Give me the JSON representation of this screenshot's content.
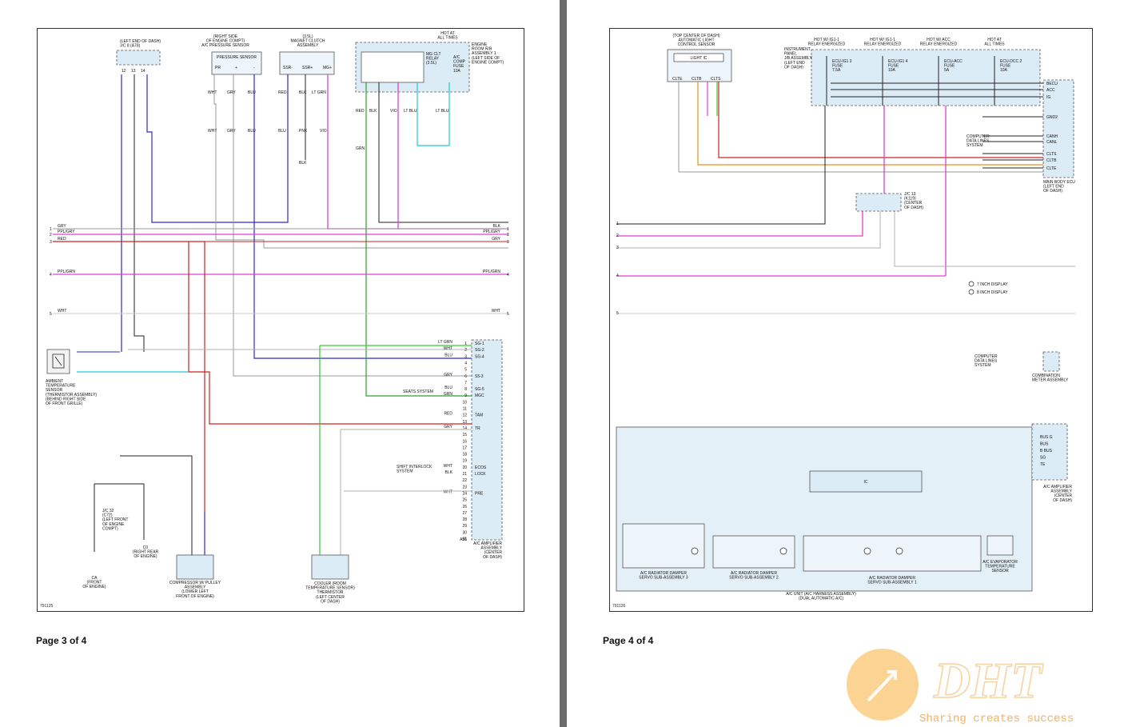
{
  "page3": {
    "footer": "Page 3 of 4",
    "diagram_id": "791125",
    "components": {
      "jc8": [
        "(LEFT END OF DASH)",
        "J/C 8 (A78)"
      ],
      "pressure_loc": [
        "(RIGHT SIDE",
        "OF ENGINE COMPT)",
        "A/C PRESSURE SENSOR"
      ],
      "pressure_box": "PRESSURE SENSOR",
      "magnet_loc": [
        "(3.5L)",
        "MAGNET CLUTCH",
        "ASSEMBLY"
      ],
      "hot": [
        "HOT AT",
        "ALL TIMES"
      ],
      "relay_assy": [
        "ENGINE",
        "ROOM R/B",
        "ASSEMBLY 1",
        "(LEFT SIDE OF",
        "ENGINE COMPT)"
      ],
      "mg_relay": [
        "MG CLT",
        "RELAY",
        "(3.5L)"
      ],
      "ac_fuse": [
        "A/C",
        "COMP",
        "FUSE",
        "10A"
      ],
      "ambient": [
        "AMBIENT",
        "TEMPERATURE",
        "SENSOR",
        "(THERMISTOR ASSEMBLY)",
        "(BEHIND RIGHT SIDE",
        "OF FRONT GRILLE)"
      ],
      "jc32": [
        "J/C 32",
        "(C72)",
        "(LEFT FRONT",
        "OF ENGINE",
        "COMPT)"
      ],
      "c0": [
        "C0",
        "(RIGHT REAR",
        "OF ENGINE)"
      ],
      "ca": [
        "CA",
        "(FRONT",
        "OF ENGINE)"
      ],
      "compressor": [
        "COMPRESSOR W/ PULLEY",
        "ASSEMBLY",
        "(LOWER LEFT",
        "FRONT OF ENGINE)"
      ],
      "cooler": [
        "COOLER (ROOM",
        "TEMPERATURE SENSOR)",
        "THERMISTOR",
        "(LEFT CENTER",
        "OF DASH)"
      ],
      "amp": [
        "A/C AMPLIFIER",
        "ASSEMBLY",
        "(CENTER",
        "OF DASH)"
      ],
      "seats": "SEATS SYSTEM",
      "shift": [
        "SHIFT INTERLOCK",
        "SYSTEM"
      ]
    },
    "bus_left": [
      {
        "num": "1",
        "color": "GRY"
      },
      {
        "num": "2",
        "color": "PPL/GRY"
      },
      {
        "num": "3",
        "color": "RED"
      },
      {
        "num": "4",
        "color": "PPL/GRN"
      },
      {
        "num": "5",
        "color": "WHT"
      }
    ],
    "bus_right": [
      {
        "num": "1",
        "color": "BLK"
      },
      {
        "num": "2",
        "color": "PPL/GRY"
      },
      {
        "num": "3",
        "color": "GRY"
      },
      {
        "num": "4",
        "color": "PPL/GRN"
      },
      {
        "num": "5",
        "color": "WHT"
      }
    ],
    "amp_pins": [
      {
        "pin": "1",
        "sig": "SG-1",
        "wire": "LT GRN"
      },
      {
        "pin": "2",
        "sig": "SG-2",
        "wire": "WHT"
      },
      {
        "pin": "3",
        "sig": "SG-4",
        "wire": "BLU"
      },
      {
        "pin": "4",
        "sig": "",
        "wire": ""
      },
      {
        "pin": "5",
        "sig": "",
        "wire": ""
      },
      {
        "pin": "6",
        "sig": "S5-3",
        "wire": "GRY"
      },
      {
        "pin": "7",
        "sig": "",
        "wire": ""
      },
      {
        "pin": "8",
        "sig": "SG-5",
        "wire": "BLU"
      },
      {
        "pin": "9",
        "sig": "MGC",
        "wire": "GRN"
      },
      {
        "pin": "10",
        "sig": "",
        "wire": ""
      },
      {
        "pin": "11",
        "sig": "",
        "wire": ""
      },
      {
        "pin": "12",
        "sig": "TAM",
        "wire": "RED"
      },
      {
        "pin": "13",
        "sig": "",
        "wire": ""
      },
      {
        "pin": "14",
        "sig": "TR",
        "wire": "GRY"
      },
      {
        "pin": "15",
        "sig": "",
        "wire": ""
      },
      {
        "pin": "16",
        "sig": "",
        "wire": ""
      },
      {
        "pin": "17",
        "sig": "",
        "wire": ""
      },
      {
        "pin": "18",
        "sig": "",
        "wire": ""
      },
      {
        "pin": "19",
        "sig": "",
        "wire": ""
      },
      {
        "pin": "20",
        "sig": "ECOS",
        "wire": "WHT"
      },
      {
        "pin": "21",
        "sig": "LOCK",
        "wire": "BLK"
      },
      {
        "pin": "22",
        "sig": "",
        "wire": ""
      },
      {
        "pin": "23",
        "sig": "",
        "wire": ""
      },
      {
        "pin": "24",
        "sig": "PRE",
        "wire": "WHT"
      },
      {
        "pin": "25",
        "sig": "",
        "wire": ""
      },
      {
        "pin": "26",
        "sig": "",
        "wire": ""
      },
      {
        "pin": "27",
        "sig": "",
        "wire": ""
      },
      {
        "pin": "28",
        "sig": "",
        "wire": ""
      },
      {
        "pin": "29",
        "sig": "",
        "wire": ""
      },
      {
        "pin": "30",
        "sig": "",
        "wire": ""
      },
      {
        "pin": "31",
        "sig": "",
        "wire": ""
      }
    ],
    "amp_connector": "A56",
    "wire_colors": {
      "blu": "#2a2ad0",
      "pink": "#e040d0",
      "red": "#d02020",
      "grn": "#2ca02c",
      "ltgrn": "#33cc33",
      "ltblu": "#22c8d8",
      "gry": "#9a9a9a",
      "blk": "#222222",
      "vio": "#a050d0"
    }
  },
  "page4": {
    "footer": "Page 4 of 4",
    "diagram_id": "791126",
    "components": {
      "light_sensor": [
        "(TOP CENTER OF DASH)",
        "AUTOMATIC LIGHT",
        "CONTROL SENSOR"
      ],
      "light_ic": "LIGHT IC",
      "light_pins": [
        "CLTE",
        "CLTB",
        "CLTS"
      ],
      "ip_jb": [
        "INSTRUMENT",
        "PANEL",
        "J/B ASSEMBLY",
        "(LEFT END",
        "OF DASH)"
      ],
      "hots": [
        {
          "top": [
            "HOT W/ IG1-1",
            "RELAY ENERGIZED"
          ],
          "fuse": [
            "ECU-IG1 3",
            "FUSE",
            "7.5A"
          ]
        },
        {
          "top": [
            "HOT W/ IG1-1",
            "RELAY ENERGIZED"
          ],
          "fuse": [
            "ECU-IG1 4",
            "FUSE",
            "10A"
          ]
        },
        {
          "top": [
            "HOT W/ ACC",
            "RELAY ENERGIZED"
          ],
          "fuse": [
            "ECU-ACC",
            "FUSE",
            "5A"
          ]
        },
        {
          "top": [
            "HOT AT",
            "ALL TIMES"
          ],
          "fuse": [
            "ECU-DCC 2",
            "FUSE",
            "10A"
          ]
        }
      ],
      "main_ecu": [
        "MAIN BODY ECU",
        "(LEFT END",
        "OF DASH)"
      ],
      "ecu_pins": [
        "BECU",
        "ACC",
        "IG",
        "GND2",
        "CANH",
        "CANL",
        "CLTS",
        "CLTB",
        "CLTE"
      ],
      "jc13": [
        "J/C 13",
        "(K119)",
        "(CENTER",
        "OF DASH)"
      ],
      "disp7": "7 INCH DISPLAY",
      "disp8": "8 INCH DISPLAY",
      "comp_lines": [
        "COMPUTER",
        "DATA LINES",
        "SYSTEM"
      ],
      "combo": [
        "COMBINATION",
        "METER ASSEMBLY"
      ],
      "ac_unit": [
        "A/C UNIT (A/C HARNESS ASSEMBLY)",
        "(DUAL AUTOMATIC A/C)"
      ],
      "ic": "IC",
      "servo3": [
        "A/C RADIATOR DAMPER",
        "SERVO SUB-ASSEMBLY 3"
      ],
      "servo2": [
        "A/C RADIATOR DAMPER",
        "SERVO SUB-ASSEMBLY 2"
      ],
      "servo1": [
        "A/C RADIATOR DAMPER",
        "SERVO SUB-ASSEMBLY 1"
      ],
      "evap": [
        "A/C EVAPORATOR",
        "TEMPERATURE",
        "SENSOR"
      ],
      "amp": [
        "A/C AMPLIFIER",
        "ASSEMBLY",
        "(CENTER",
        "OF DASH)"
      ],
      "amp_pins": [
        "BUS G",
        "BUS",
        "B BUS",
        "SG",
        "TE"
      ]
    }
  },
  "watermark": {
    "brand": "DHT",
    "slogan": "Sharing creates success"
  }
}
